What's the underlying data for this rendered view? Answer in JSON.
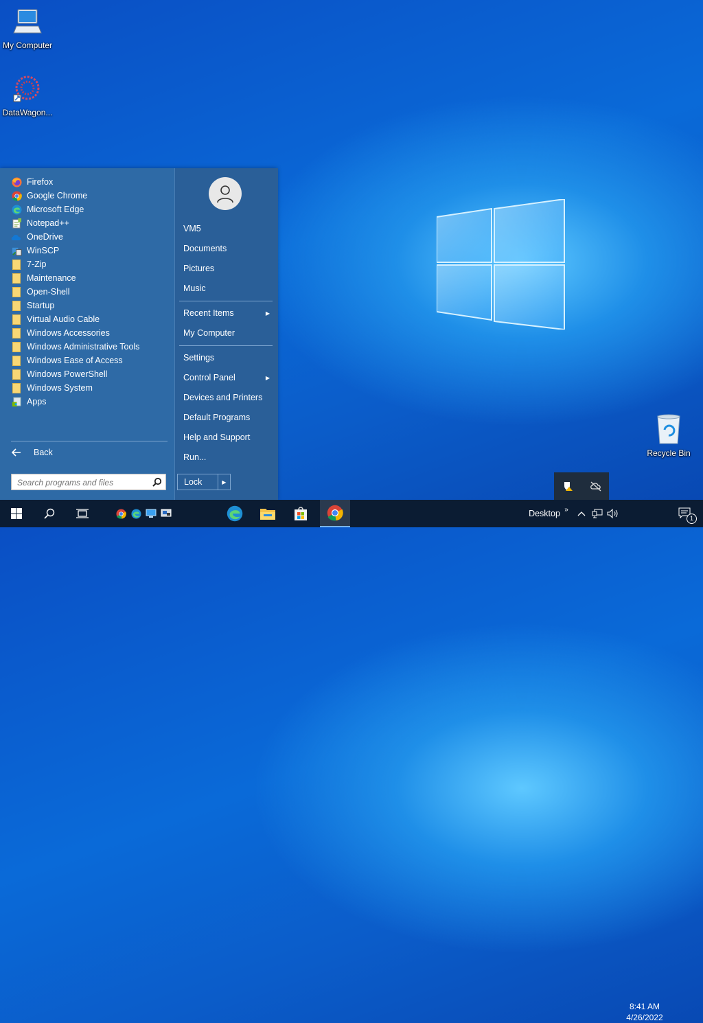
{
  "desktop": {
    "icons": [
      {
        "label": "My Computer"
      },
      {
        "label": "DataWagon..."
      },
      {
        "label": "Recycle Bin"
      }
    ]
  },
  "start_menu": {
    "programs": [
      {
        "label": "Firefox",
        "icon": "firefox-icon"
      },
      {
        "label": "Google Chrome",
        "icon": "chrome-icon"
      },
      {
        "label": "Microsoft Edge",
        "icon": "edge-icon"
      },
      {
        "label": "Notepad++",
        "icon": "notepadpp-icon"
      },
      {
        "label": "OneDrive",
        "icon": "onedrive-icon"
      },
      {
        "label": "WinSCP",
        "icon": "winscp-icon"
      },
      {
        "label": "7-Zip",
        "icon": "folder-icon"
      },
      {
        "label": "Maintenance",
        "icon": "folder-icon"
      },
      {
        "label": "Open-Shell",
        "icon": "folder-icon"
      },
      {
        "label": "Startup",
        "icon": "folder-icon"
      },
      {
        "label": "Virtual Audio Cable",
        "icon": "folder-icon"
      },
      {
        "label": "Windows Accessories",
        "icon": "folder-icon"
      },
      {
        "label": "Windows Administrative Tools",
        "icon": "folder-icon"
      },
      {
        "label": "Windows Ease of Access",
        "icon": "folder-icon"
      },
      {
        "label": "Windows PowerShell",
        "icon": "folder-icon"
      },
      {
        "label": "Windows System",
        "icon": "folder-icon"
      },
      {
        "label": "Apps",
        "icon": "apps-icon"
      }
    ],
    "back_label": "Back",
    "search_placeholder": "Search programs and files",
    "right_items": [
      {
        "label": "VM5",
        "submenu": false
      },
      {
        "label": "Documents",
        "submenu": false
      },
      {
        "label": "Pictures",
        "submenu": false
      },
      {
        "label": "Music",
        "submenu": false
      },
      {
        "label": "Recent Items",
        "submenu": true
      },
      {
        "label": "My Computer",
        "submenu": false
      },
      {
        "label": "Settings",
        "submenu": false
      },
      {
        "label": "Control Panel",
        "submenu": true
      },
      {
        "label": "Devices and Printers",
        "submenu": false
      },
      {
        "label": "Default Programs",
        "submenu": false
      },
      {
        "label": "Help and Support",
        "submenu": false
      },
      {
        "label": "Run...",
        "submenu": false
      }
    ],
    "lock_label": "Lock"
  },
  "taskbar": {
    "desktop_label": "Desktop",
    "time": "8:41 AM",
    "date": "4/26/2022",
    "notification_count": "1"
  },
  "colors": {
    "menu_bg": "#2e6aa6",
    "taskbar_bg": "#0b1c33",
    "accent": "#0078d7"
  }
}
